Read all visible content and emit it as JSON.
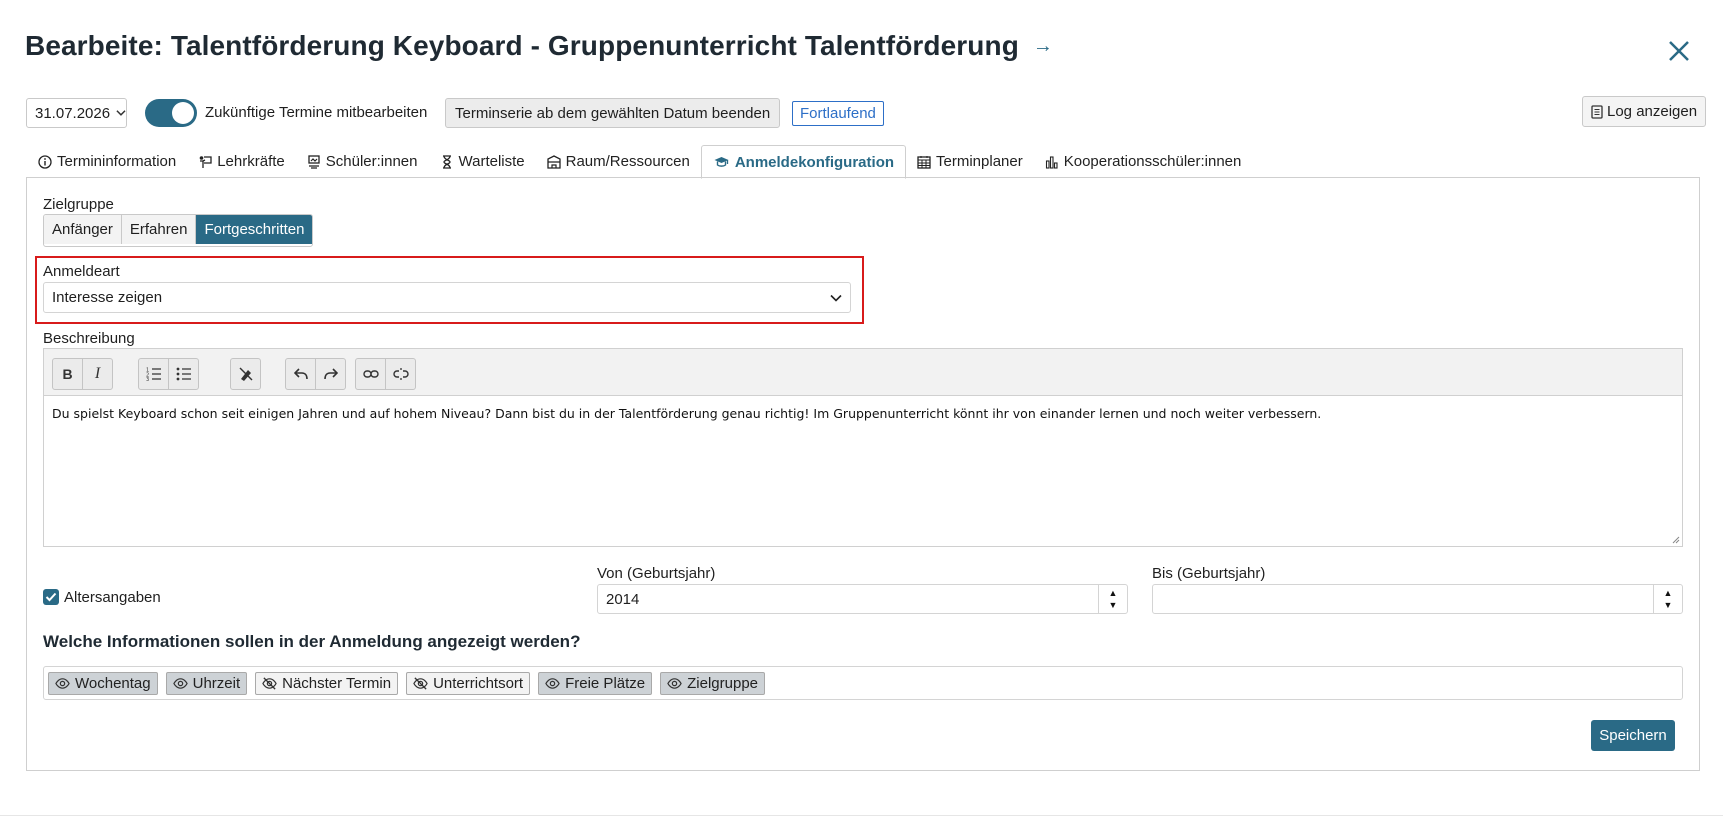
{
  "header": {
    "title": "Bearbeite: Talentförderung Keyboard - Gruppenunterricht Talentförderung",
    "title_arrow": "→"
  },
  "toolbar": {
    "date": "31.07.2026",
    "toggle_label": "Zukünftige Termine mitbearbeiten",
    "toggle_on": true,
    "end_series_button": "Terminserie ab dem gewählten Datum beenden",
    "status_badge": "Fortlaufend",
    "log_button": "Log anzeigen"
  },
  "tabs": [
    {
      "label": "Termininformation",
      "icon": "info-icon"
    },
    {
      "label": "Lehrkräfte",
      "icon": "teacher-icon"
    },
    {
      "label": "Schüler:innen",
      "icon": "students-icon"
    },
    {
      "label": "Warteliste",
      "icon": "hourglass-icon"
    },
    {
      "label": "Raum/Ressourcen",
      "icon": "building-icon"
    },
    {
      "label": "Anmeldekonfiguration",
      "icon": "graduation-cap-icon",
      "active": true
    },
    {
      "label": "Terminplaner",
      "icon": "calendar-icon"
    },
    {
      "label": "Kooperationsschüler:innen",
      "icon": "bar-chart-icon"
    }
  ],
  "form": {
    "zielgruppe_label": "Zielgruppe",
    "zielgruppe_options": [
      "Anfänger",
      "Erfahren",
      "Fortgeschritten"
    ],
    "zielgruppe_selected": "Fortgeschritten",
    "anmeldeart_label": "Anmeldeart",
    "anmeldeart_value": "Interesse zeigen",
    "beschreibung_label": "Beschreibung",
    "beschreibung_text": "Du spielst Keyboard schon seit einigen Jahren und auf hohem Niveau? Dann bist du in der Talentförderung genau richtig! Im Gruppenunterricht könnt ihr von einander lernen und noch weiter verbessern.",
    "altersangaben_label": "Altersangaben",
    "altersangaben_checked": true,
    "von_label": "Von (Geburtsjahr)",
    "von_value": "2014",
    "bis_label": "Bis (Geburtsjahr)",
    "bis_value": "",
    "info_question": "Welche Informationen sollen in der Anmeldung angezeigt werden?",
    "info_chips": [
      {
        "label": "Wochentag",
        "visible": true
      },
      {
        "label": "Uhrzeit",
        "visible": true
      },
      {
        "label": "Nächster Termin",
        "visible": false
      },
      {
        "label": "Unterrichtsort",
        "visible": false
      },
      {
        "label": "Freie Plätze",
        "visible": true
      },
      {
        "label": "Zielgruppe",
        "visible": true
      }
    ],
    "save_button": "Speichern"
  },
  "editor_toolbar": {
    "bold": "B",
    "italic": "I"
  },
  "colors": {
    "accent": "#2a6a86",
    "highlight_border": "#d81b1b",
    "badge": "#2d6fc7"
  }
}
